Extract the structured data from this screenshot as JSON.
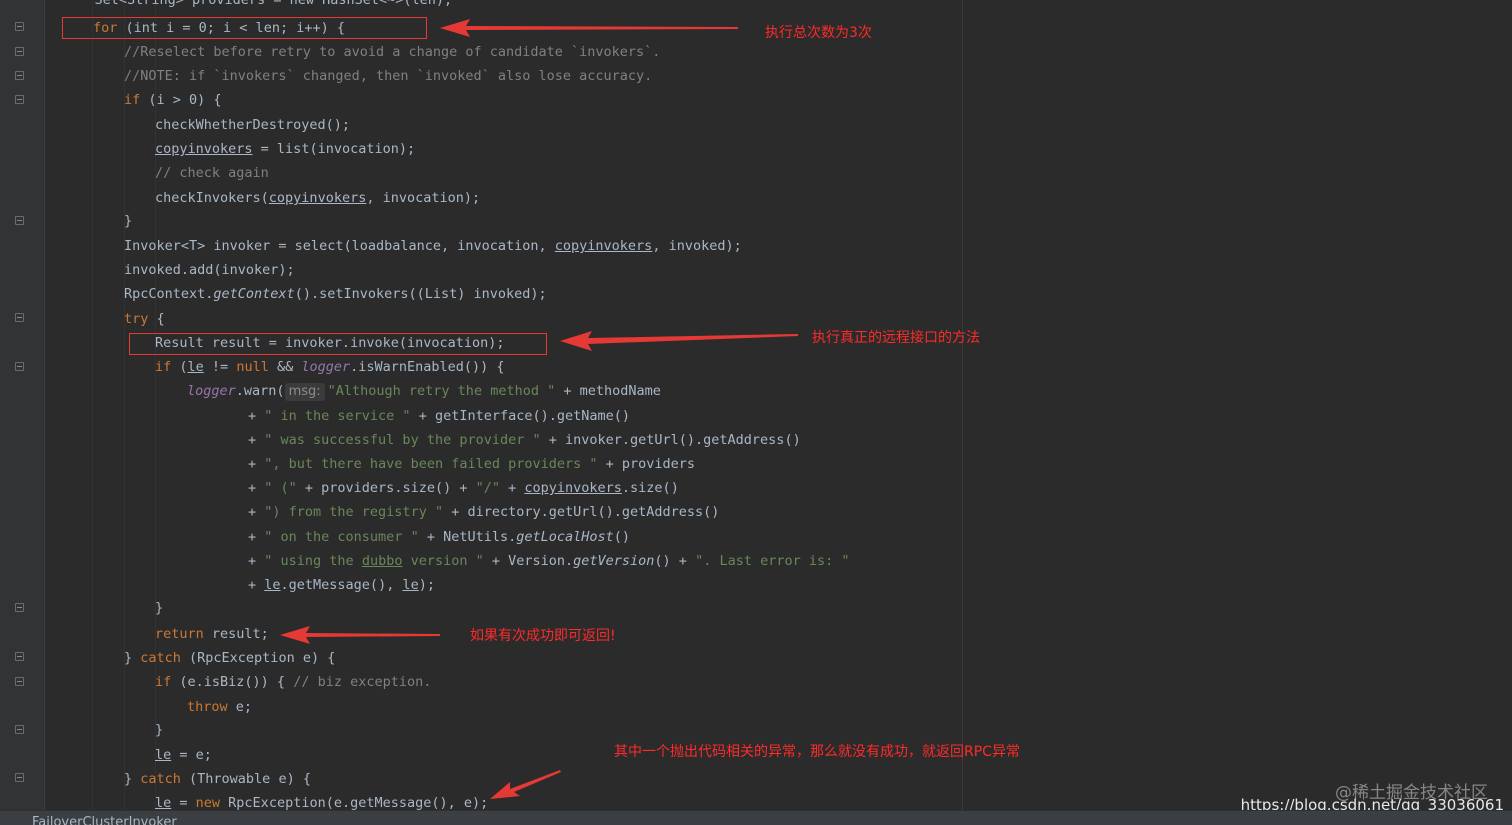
{
  "editor": {
    "lines": {
      "l0": "    Set<String> providers = new HashSet<~>(len);",
      "l1_kw": "for",
      "l1_rest": " (int i = 0; i < len; i++) {",
      "l2": "//Reselect before retry to avoid a change of candidate `invokers`.",
      "l3": "//NOTE: if `invokers` changed, then `invoked` also lose accuracy.",
      "l4_kw": "if",
      "l4_rest": " (i > 0) {",
      "l5": "checkWhetherDestroyed();",
      "l6_a": "copyinvokers",
      "l6_b": " = list(invocation);",
      "l7": "// check again",
      "l8_a": "checkInvokers(",
      "l8_b": "copyinvokers",
      "l8_c": ", invocation);",
      "l9": "}",
      "l10_a": "Invoker<T> invoker = select(loadbalance, invocation, ",
      "l10_b": "copyinvokers",
      "l10_c": ", invoked);",
      "l11": "invoked.add(invoker);",
      "l12_a": "RpcContext.",
      "l12_b": "getContext",
      "l12_c": "().setInvokers((List) invoked);",
      "l13_kw": "try",
      "l13_rest": " {",
      "l14": "Result result = invoker.invoke(invocation);",
      "l15_kw": "if",
      "l15_a": " (",
      "l15_b": "le",
      "l15_c": " != ",
      "l15_d": "null",
      "l15_e": " && ",
      "l15_f": "logger",
      "l15_g": ".isWarnEnabled()) {",
      "l16_a": "logger",
      "l16_b": ".warn(",
      "l16_hint": "msg:",
      "l16_str": "\"Although retry the method \"",
      "l16_c": " + methodName",
      "l17_a": "+ ",
      "l17_str": "\" in the service \"",
      "l17_b": " + getInterface().getName()",
      "l18_a": "+ ",
      "l18_str": "\" was successful by the provider \"",
      "l18_b": " + invoker.getUrl().getAddress()",
      "l19_a": "+ ",
      "l19_str": "\", but there have been failed providers \"",
      "l19_b": " + providers",
      "l20_a": "+ ",
      "l20_str": "\" (\"",
      "l20_b": " + providers.size() + ",
      "l20_str2": "\"/\"",
      "l20_c": " + ",
      "l20_d": "copyinvokers",
      "l20_e": ".size()",
      "l21_a": "+ ",
      "l21_str": "\") from the registry \"",
      "l21_b": " + directory.getUrl().getAddress()",
      "l22_a": "+ ",
      "l22_str": "\" on the consumer \"",
      "l22_b": " + NetUtils.",
      "l22_c": "getLocalHost",
      "l22_d": "()",
      "l23_a": "+ ",
      "l23_str": "\" using the ",
      "l23_u": "dubbo",
      "l23_str2": " version \"",
      "l23_b": " + Version.",
      "l23_c": "getVersion",
      "l23_d": "() + ",
      "l23_str3": "\". Last error is: \"",
      "l24_a": "+ ",
      "l24_b": "le",
      "l24_c": ".getMessage(), ",
      "l24_d": "le",
      "l24_e": ");",
      "l25": "}",
      "l26_kw": "return",
      "l26_rest": " result;",
      "l27_a": "} ",
      "l27_kw": "catch",
      "l27_b": " (RpcException e) {",
      "l28_kw": "if",
      "l28_b": " (e.isBiz()) { ",
      "l28_cm": "// biz exception.",
      "l29_kw": "throw",
      "l29_b": " e;",
      "l30": "}",
      "l31_a": "le",
      "l31_b": " = e;",
      "l32_a": "} ",
      "l32_kw": "catch",
      "l32_b": " (Throwable e) {",
      "l33_a": "le",
      "l33_b": " = ",
      "l33_kw": "new",
      "l33_c": " RpcException(e.getMessage(), e);"
    }
  },
  "annotations": {
    "note1": "执行总次数为3次",
    "note2": "执行真正的远程接口的方法",
    "note3": "如果有次成功即可返回!",
    "note4": "其中一个抛出代码相关的异常，那么就没有成功，就返回RPC异常"
  },
  "status": {
    "file": "FailoverClusterInvoker"
  },
  "watermark": {
    "site": "@稀土掘金技术社区",
    "url": "https://blog.csdn.net/qq_33036061"
  },
  "colors": {
    "background": "#2b2b2b",
    "keyword": "#cc7832",
    "string": "#6a8759",
    "comment": "#808080",
    "annotation": "#e53935"
  }
}
